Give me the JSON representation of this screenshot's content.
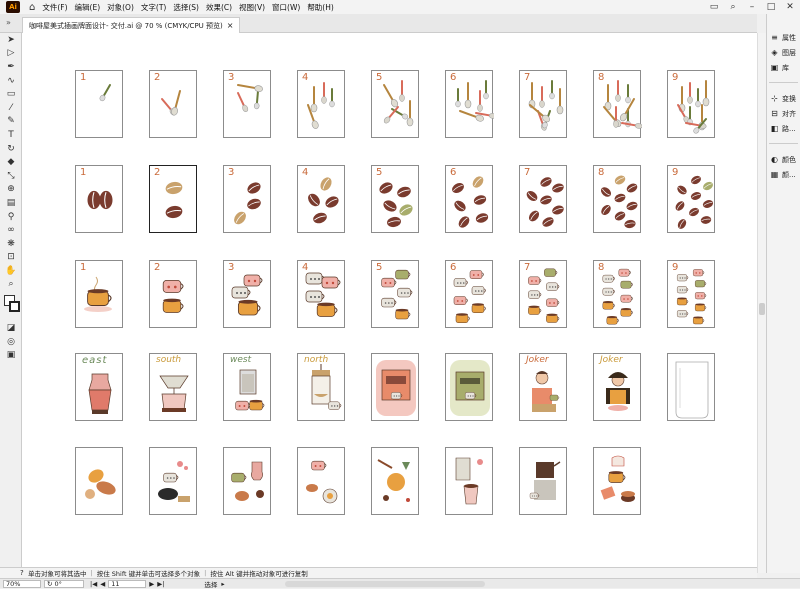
{
  "app": {
    "logo_text": "Ai",
    "brand_color": "#ff9a00"
  },
  "menu": {
    "items": [
      "文件(F)",
      "编辑(E)",
      "对象(O)",
      "文字(T)",
      "选择(S)",
      "效果(C)",
      "视图(V)",
      "窗口(W)",
      "帮助(H)"
    ]
  },
  "document": {
    "tab_title": "咖啡屋美式插画牌面设计- 交付.ai @ 70 % (CMYK/CPU 预览)",
    "close_glyph": "×"
  },
  "panels": {
    "items": [
      {
        "icon": "properties-icon",
        "glyph": "≡",
        "label": "属性"
      },
      {
        "icon": "layers-icon",
        "glyph": "◈",
        "label": "图层"
      },
      {
        "icon": "libraries-icon",
        "glyph": "▣",
        "label": "库"
      },
      {
        "icon": "transform-icon",
        "glyph": "⊹",
        "label": "变换"
      },
      {
        "icon": "align-icon",
        "glyph": "⊟",
        "label": "对齐"
      },
      {
        "icon": "pathfinder-icon",
        "glyph": "◧",
        "label": "路..."
      },
      {
        "icon": "color-icon",
        "glyph": "◐",
        "label": "颜色"
      },
      {
        "icon": "swatches-icon",
        "glyph": "▦",
        "label": "颜..."
      }
    ]
  },
  "status": {
    "hint_parts": [
      "单击对象可将其选中",
      "按住 Shift 键并单击可选择多个对象",
      "按住 Alt 键并拖动对象可进行复制"
    ],
    "zoom": "70%",
    "rotate": "0°",
    "artboard": "11",
    "tool_label": "选择"
  },
  "artboards": {
    "row1": [
      "1",
      "2",
      "3",
      "4",
      "5",
      "6",
      "7",
      "8",
      "9"
    ],
    "row2": [
      "1",
      "2",
      "3",
      "4",
      "5",
      "6",
      "7",
      "8",
      "9"
    ],
    "row3": [
      "1",
      "2",
      "3",
      "4",
      "5",
      "6",
      "7",
      "8",
      "9"
    ],
    "row4": [
      "east",
      "south",
      "west",
      "north",
      "",
      "",
      "Joker",
      "Joker",
      ""
    ]
  },
  "colors": {
    "number": "#c96a3a",
    "bean_dark": "#7a3b2e",
    "bean_light": "#c9a26c",
    "cup_orange": "#e8a040",
    "accent_pink": "#e88b8b"
  }
}
